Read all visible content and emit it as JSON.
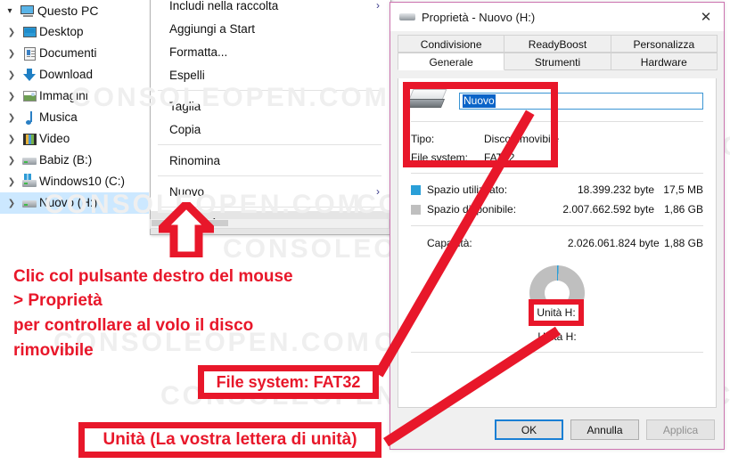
{
  "watermark": {
    "text": "CONSOLEOPEN.COM"
  },
  "explorer": {
    "tree": [
      {
        "label": "Questo PC",
        "icon": "computer-icon",
        "expanded": true,
        "level": 0
      },
      {
        "label": "Desktop",
        "icon": "desktop-icon",
        "expanded": false,
        "level": 1
      },
      {
        "label": "Documenti",
        "icon": "documents-icon",
        "expanded": false,
        "level": 1
      },
      {
        "label": "Download",
        "icon": "downloads-icon",
        "expanded": false,
        "level": 1
      },
      {
        "label": "Immagini",
        "icon": "pictures-icon",
        "expanded": false,
        "level": 1
      },
      {
        "label": "Musica",
        "icon": "music-icon",
        "expanded": false,
        "level": 1
      },
      {
        "label": "Video",
        "icon": "video-icon",
        "expanded": false,
        "level": 1
      },
      {
        "label": "Babiz (B:)",
        "icon": "drive-icon",
        "expanded": false,
        "level": 1
      },
      {
        "label": "Windows10 (C:)",
        "icon": "windows-drive-icon",
        "expanded": false,
        "level": 1
      },
      {
        "label": "Nuovo (H:)",
        "icon": "drive-icon",
        "expanded": false,
        "level": 1,
        "selected": true
      }
    ]
  },
  "context_menu": {
    "items": [
      {
        "label": "Includi nella raccolta",
        "submenu": true
      },
      {
        "label": "Aggiungi a Start",
        "submenu": false
      },
      {
        "label": "Formatta...",
        "submenu": false
      },
      {
        "label": "Espelli",
        "submenu": false
      },
      {
        "separator": true
      },
      {
        "label": "Taglia",
        "submenu": false
      },
      {
        "label": "Copia",
        "submenu": false
      },
      {
        "separator": true
      },
      {
        "label": "Rinomina",
        "submenu": false
      },
      {
        "separator": true
      },
      {
        "label": "Nuovo",
        "submenu": true
      },
      {
        "separator": true
      },
      {
        "label": "Proprietà",
        "submenu": false,
        "highlighted": true
      }
    ],
    "submenu_glyph": "›"
  },
  "dialog": {
    "title": "Proprietà - Nuovo (H:)",
    "close_glyph": "✕",
    "tabs_row1": [
      {
        "label": "Condivisione",
        "active": false
      },
      {
        "label": "ReadyBoost",
        "active": false
      },
      {
        "label": "Personalizza",
        "active": false
      }
    ],
    "tabs_row2": [
      {
        "label": "Generale",
        "active": true
      },
      {
        "label": "Strumenti",
        "active": false
      },
      {
        "label": "Hardware",
        "active": false
      }
    ],
    "volume_name": "Nuovo",
    "info": [
      {
        "key": "Tipo:",
        "value": "Disco rimovibile"
      },
      {
        "key": "File system:",
        "value": "FAT32"
      }
    ],
    "usage": [
      {
        "label": "Spazio utilizzato:",
        "bytes": "18.399.232 byte",
        "human": "17,5 MB",
        "color": "#2a9fd8"
      },
      {
        "label": "Spazio disponibile:",
        "bytes": "2.007.662.592 byte",
        "human": "1,86 GB",
        "color": "#bfbfbf"
      }
    ],
    "capacity": {
      "label": "Capacità:",
      "bytes": "2.026.061.824 byte",
      "human": "1,88 GB"
    },
    "drive_letter_label": "Unità H:",
    "buttons": [
      {
        "label": "OK",
        "state": "default"
      },
      {
        "label": "Annulla",
        "state": "normal"
      },
      {
        "label": "Applica",
        "state": "disabled"
      }
    ]
  },
  "annotations": {
    "instruction_lines": [
      "Clic col pulsante destro del mouse",
      "> Proprietà",
      " per controllare al volo il disco",
      "rimovibile"
    ],
    "callout_filesystem": "File system: FAT32",
    "callout_unit": "Unità (La vostra lettera di unità)",
    "accent_color": "#e8172a"
  }
}
